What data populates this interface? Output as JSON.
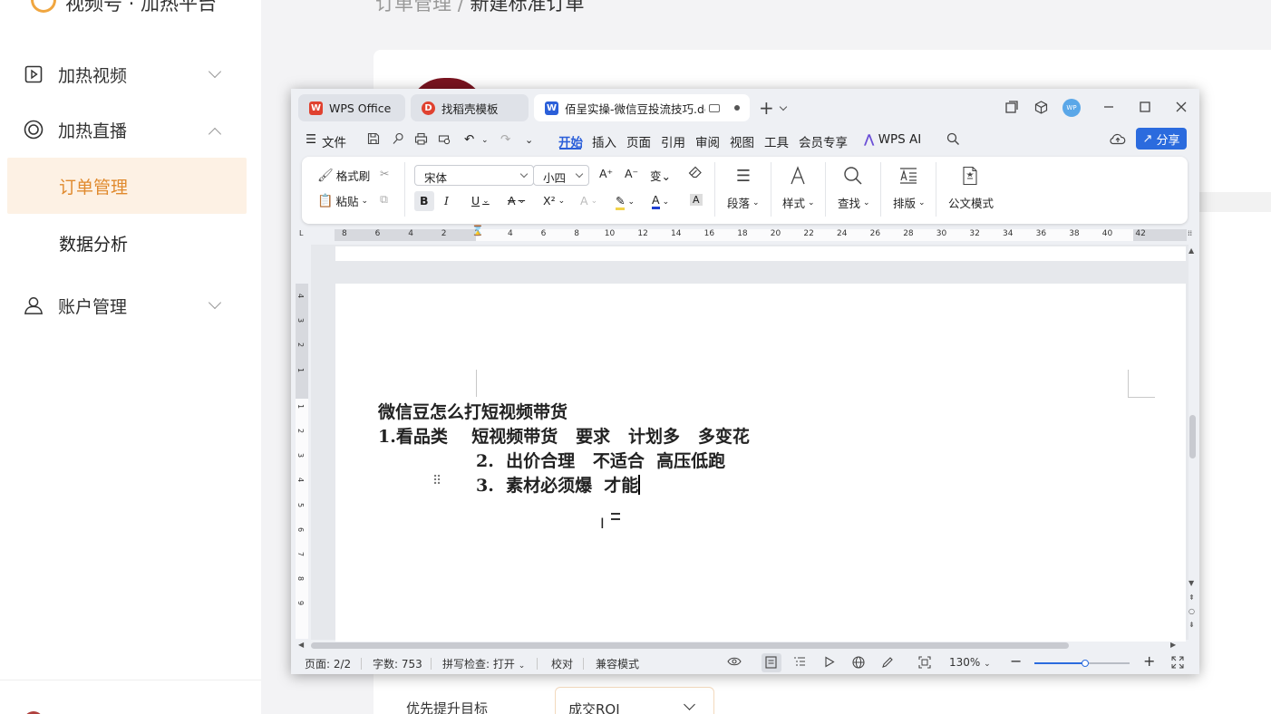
{
  "app": {
    "brand": "视频号 · 加热平台",
    "breadcrumb": {
      "parent": "订单管理",
      "separator": "/",
      "current": "新建标准订单"
    },
    "sidebar": {
      "items": [
        {
          "label": "加热视频",
          "icon": "video-play-icon",
          "expanded": false
        },
        {
          "label": "加热直播",
          "icon": "live-circle-icon",
          "expanded": true
        },
        {
          "label": "订单管理",
          "sub": true,
          "active": true
        },
        {
          "label": "数据分析",
          "sub": true,
          "active": false
        },
        {
          "label": "账户管理",
          "icon": "account-user-icon",
          "expanded": false
        }
      ]
    },
    "form": {
      "label": "优先提升目标",
      "select_value": "成交ROI"
    },
    "accent_color": "#e08a2e"
  },
  "wps": {
    "tabs": [
      {
        "label": "WPS Office",
        "icon": "wps-logo-icon"
      },
      {
        "label": "找稻壳模板",
        "icon": "docer-icon"
      },
      {
        "label": "佰呈实操-微信豆投流技巧.docx",
        "icon": "word-doc-icon",
        "active": true
      }
    ],
    "avatar_text": "WP",
    "menu": {
      "file": "文件",
      "items": [
        "开始",
        "插入",
        "页面",
        "引用",
        "审阅",
        "视图",
        "工具",
        "会员专享"
      ],
      "active": "开始",
      "ai": "WPS AI",
      "share": "分享"
    },
    "ribbon": {
      "format_painter": "格式刷",
      "paste": "粘贴",
      "font_name": "宋体",
      "font_size": "小四",
      "paragraph": "段落",
      "styles": "样式",
      "find": "查找",
      "layout": "排版",
      "official_doc": "公文模式",
      "font_color": "#1f3fd1",
      "highlight_color": "#f2d34b"
    },
    "ruler_h": [
      "8",
      "6",
      "4",
      "2",
      "2",
      "4",
      "6",
      "8",
      "10",
      "12",
      "14",
      "16",
      "18",
      "20",
      "22",
      "24",
      "26",
      "28",
      "30",
      "32",
      "34",
      "36",
      "38",
      "40",
      "42"
    ],
    "ruler_v": [
      "4",
      "3",
      "2",
      "1",
      "1",
      "2",
      "3",
      "4",
      "5",
      "6",
      "7",
      "8",
      "9"
    ],
    "document": {
      "lines": [
        "微信豆怎么打短视频带货",
        "1.看品类    短视频带货   要求   计划多   多变花",
        "2.  出价合理   不适合  高压低跑",
        "3.  素材必须爆  才能"
      ]
    },
    "status": {
      "page": "页面: 2/2",
      "words": "字数: 753",
      "spell": "拼写检查: 打开",
      "proof": "校对",
      "compat": "兼容模式",
      "zoom": "130%",
      "zoom_fraction": 0.53
    }
  }
}
